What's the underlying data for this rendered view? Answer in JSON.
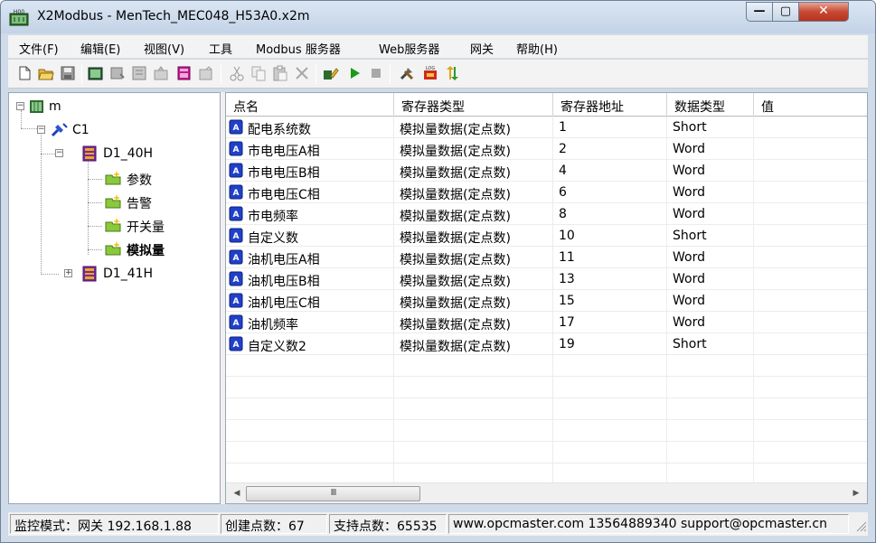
{
  "window": {
    "title": "X2Modbus - MenTech_MEC048_H53A0.x2m",
    "minimize_glyph": "—",
    "maximize_glyph": "▢",
    "close_glyph": "✕"
  },
  "menu": [
    "文件(F)",
    "编辑(E)",
    "视图(V)",
    "工具",
    "Modbus 服务器",
    "Web服务器",
    "网关",
    "帮助(H)"
  ],
  "toolbar": {
    "icons": [
      "new-file-icon",
      "open-folder-icon",
      "save-icon",
      "add-channel-icon",
      "add-device-icon",
      "add-group-icon",
      "add-point-icon",
      "import-icon",
      "properties-icon",
      "cut-icon",
      "copy-icon",
      "paste-icon",
      "delete-icon",
      "monitor-icon",
      "run-icon",
      "stop-icon",
      "tools-icon",
      "log-icon",
      "data-transfer-icon"
    ]
  },
  "tree": {
    "root": "m",
    "channel": "C1",
    "device1": "D1_40H",
    "groups": [
      "参数",
      "告警",
      "开关量",
      "模拟量"
    ],
    "device2": "D1_41H"
  },
  "grid": {
    "columns": [
      "点名",
      "寄存器类型",
      "寄存器地址",
      "数据类型",
      "值"
    ],
    "rows": [
      {
        "name": "配电系统数",
        "reg_type": "模拟量数据(定点数)",
        "address": "1",
        "data_type": "Short",
        "value": ""
      },
      {
        "name": "市电电压A相",
        "reg_type": "模拟量数据(定点数)",
        "address": "2",
        "data_type": "Word",
        "value": ""
      },
      {
        "name": "市电电压B相",
        "reg_type": "模拟量数据(定点数)",
        "address": "4",
        "data_type": "Word",
        "value": ""
      },
      {
        "name": "市电电压C相",
        "reg_type": "模拟量数据(定点数)",
        "address": "6",
        "data_type": "Word",
        "value": ""
      },
      {
        "name": "市电频率",
        "reg_type": "模拟量数据(定点数)",
        "address": "8",
        "data_type": "Word",
        "value": ""
      },
      {
        "name": "自定义数",
        "reg_type": "模拟量数据(定点数)",
        "address": "10",
        "data_type": "Short",
        "value": ""
      },
      {
        "name": "油机电压A相",
        "reg_type": "模拟量数据(定点数)",
        "address": "11",
        "data_type": "Word",
        "value": ""
      },
      {
        "name": "油机电压B相",
        "reg_type": "模拟量数据(定点数)",
        "address": "13",
        "data_type": "Word",
        "value": ""
      },
      {
        "name": "油机电压C相",
        "reg_type": "模拟量数据(定点数)",
        "address": "15",
        "data_type": "Word",
        "value": ""
      },
      {
        "name": "油机频率",
        "reg_type": "模拟量数据(定点数)",
        "address": "17",
        "data_type": "Word",
        "value": ""
      },
      {
        "name": "自定义数2",
        "reg_type": "模拟量数据(定点数)",
        "address": "19",
        "data_type": "Short",
        "value": ""
      }
    ],
    "scroll_grip": "III",
    "scroll_left_glyph": "◀",
    "scroll_right_glyph": "▶"
  },
  "status": {
    "mode": "监控模式：网关 192.168.1.88",
    "created": "创建点数：67",
    "supported": "支持点数：65535",
    "contact": "www.opcmaster.com 13564889340 support@opcmaster.cn"
  },
  "colors": {
    "titlebar": "#c3d3e6",
    "close_button": "#c74a33",
    "run_green": "#1a9a1a",
    "point_icon_blue": "#2140c9"
  }
}
